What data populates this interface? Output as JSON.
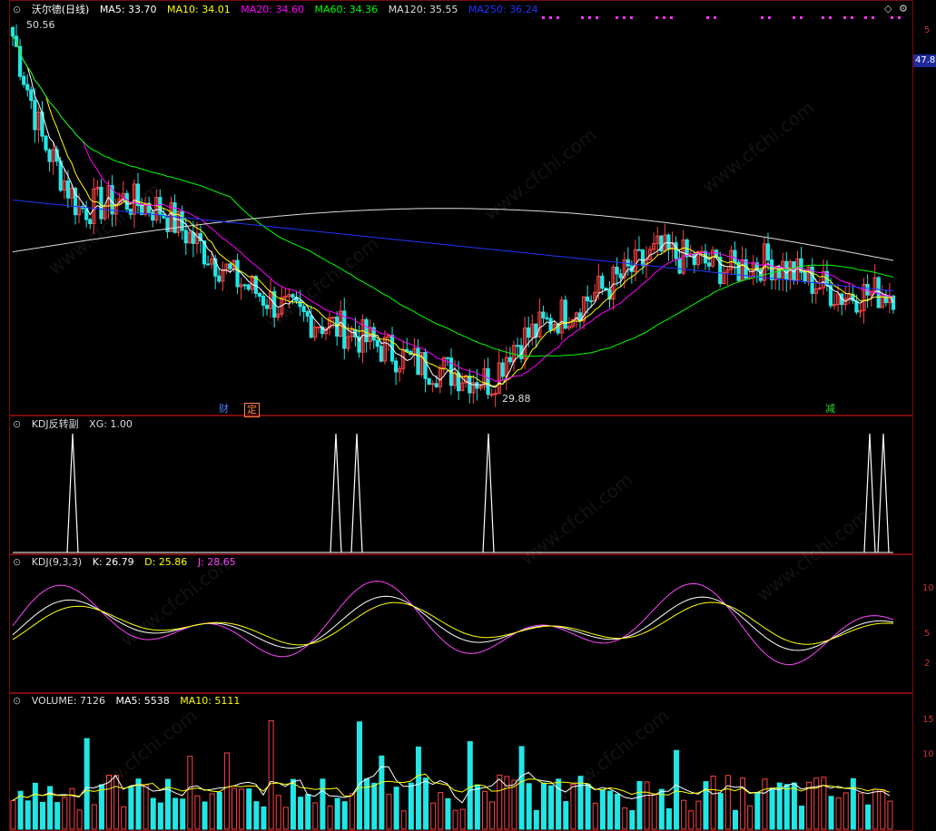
{
  "main": {
    "title": "沃尔德(日线)",
    "ma_values": [
      {
        "label": "MA5: 33.70",
        "color": "#ffffff"
      },
      {
        "label": "MA10: 34.01",
        "color": "#ffff00"
      },
      {
        "label": "MA20: 34.60",
        "color": "#ff00ff"
      },
      {
        "label": "MA60: 34.36",
        "color": "#00ff00"
      },
      {
        "label": "MA120: 35.55",
        "color": "#dddddd"
      },
      {
        "label": "MA250: 36.24",
        "color": "#2233ff"
      }
    ],
    "high_label": "50.56",
    "low_label": "29.88",
    "current_price_tag": "47.8",
    "axis_tick": "5",
    "tags": [
      {
        "text": "财",
        "color": "#4a7bff"
      },
      {
        "text": "定",
        "color": "#ff8844"
      },
      {
        "text": "减",
        "color": "#33dd33"
      }
    ]
  },
  "kdj_signal": {
    "title": "KDJ反转副",
    "value": "XG: 1.00",
    "peaks": [
      80,
      370,
      393,
      538,
      958,
      973
    ]
  },
  "kdj": {
    "title": "KDJ(9,3,3)",
    "k": {
      "label": "K: 26.79",
      "color": "#ffffff"
    },
    "d": {
      "label": "D: 25.86",
      "color": "#ffff00"
    },
    "j": {
      "label": "J: 28.65",
      "color": "#ff44ff"
    },
    "axis_ticks": [
      "10",
      "5",
      "2"
    ]
  },
  "volume": {
    "title": "VOLUME: 7126",
    "ma5": {
      "label": "MA5: 5538",
      "color": "#ffffff"
    },
    "ma10": {
      "label": "MA10: 5111",
      "color": "#ffff00"
    },
    "axis_ticks": [
      "15",
      "10"
    ]
  },
  "controls": {
    "diamond": "◇",
    "gear": "⚙"
  },
  "watermark": "www.cfchi.com"
}
